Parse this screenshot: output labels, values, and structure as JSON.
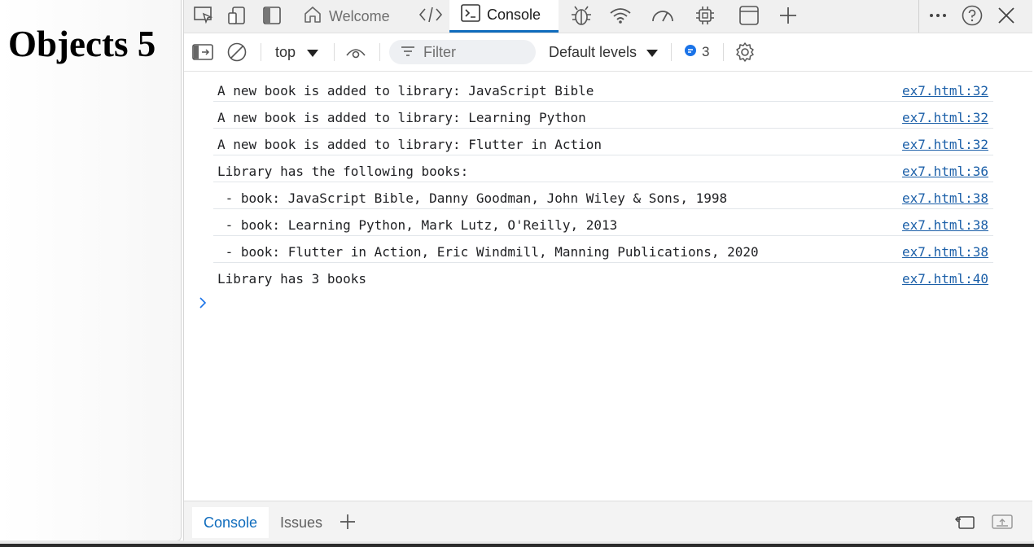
{
  "page": {
    "heading": "Objects 5"
  },
  "devtools": {
    "tabs": {
      "welcome": "Welcome",
      "console": "Console"
    },
    "toolbar": {
      "context": "top",
      "filter_placeholder": "Filter",
      "levels": "Default levels",
      "message_count": "3"
    },
    "console_messages": [
      {
        "text": "A new book is added to library: JavaScript Bible",
        "source": "ex7.html:32"
      },
      {
        "text": "A new book is added to library: Learning Python",
        "source": "ex7.html:32"
      },
      {
        "text": "A new book is added to library: Flutter in Action",
        "source": "ex7.html:32"
      },
      {
        "text": "Library has the following books:",
        "source": "ex7.html:36"
      },
      {
        "text": " - book: JavaScript Bible, Danny Goodman, John Wiley & Sons, 1998",
        "source": "ex7.html:38"
      },
      {
        "text": " - book: Learning Python, Mark Lutz, O'Reilly, 2013",
        "source": "ex7.html:38"
      },
      {
        "text": " - book: Flutter in Action, Eric Windmill, Manning Publications, 2020",
        "source": "ex7.html:38"
      },
      {
        "text": "Library has 3 books",
        "source": "ex7.html:40"
      }
    ],
    "drawer_tabs": {
      "console": "Console",
      "issues": "Issues"
    }
  },
  "colors": {
    "accent": "#0f6cbd",
    "link": "#1b5fa8",
    "prompt": "#1a73e8"
  }
}
